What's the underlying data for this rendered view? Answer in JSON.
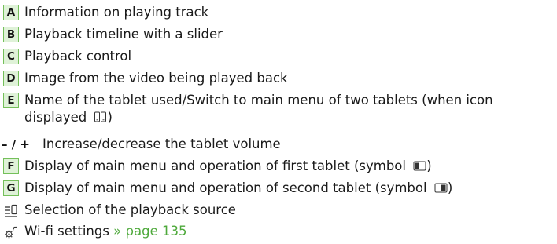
{
  "legend": {
    "items": [
      {
        "key": "A",
        "text": "Information on playing track"
      },
      {
        "key": "B",
        "text": "Playback timeline with a slider"
      },
      {
        "key": "C",
        "text": "Playback control"
      },
      {
        "key": "D",
        "text": "Image from the video being played back"
      },
      {
        "key": "E",
        "text_line1": "Name of the tablet used/Switch to main menu of two tablets (when icon",
        "text_line2": "displayed",
        "text_line2_end": ")",
        "icon": "two-tablets-icon"
      },
      {
        "key": "– / +",
        "text": "Increase/decrease the tablet volume"
      },
      {
        "key": "F",
        "text": "Display of main menu and operation of first tablet (symbol",
        "text_end": ")",
        "icon": "tablet-left-icon"
      },
      {
        "key": "G",
        "text": "Display of main menu and operation of second tablet (symbol",
        "text_end": ")",
        "icon": "tablet-right-icon"
      },
      {
        "key_icon": "playback-source-icon",
        "text": "Selection of the playback source"
      },
      {
        "key_icon": "wifi-settings-icon",
        "text": "Wi-fi settings",
        "link": "» page 135"
      }
    ]
  },
  "colors": {
    "key_border": "#74c05a",
    "key_fill": "#dff2d8",
    "link": "#4ea93b",
    "text": "#1a1a1a"
  }
}
